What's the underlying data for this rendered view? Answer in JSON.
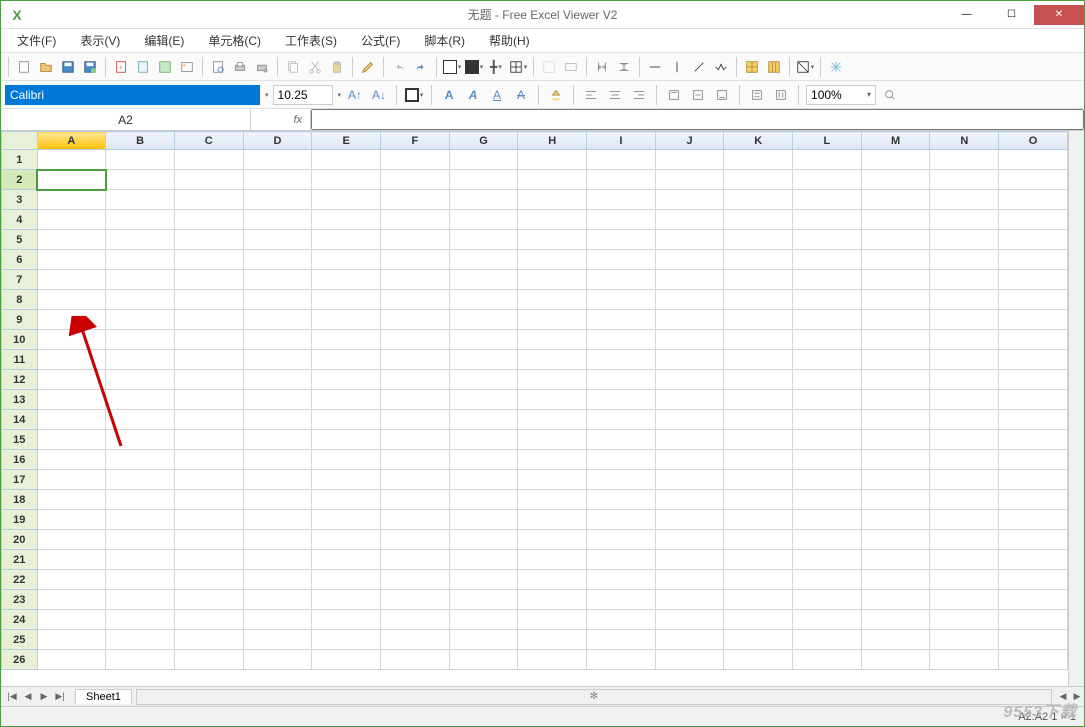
{
  "title": "无题 - Free Excel Viewer V2",
  "app_icon_letter": "X",
  "menus": [
    "文件(F)",
    "表示(V)",
    "编辑(E)",
    "单元格(C)",
    "工作表(S)",
    "公式(F)",
    "脚本(R)",
    "帮助(H)"
  ],
  "font": {
    "name": "Calibri",
    "size": "10.25"
  },
  "zoom": "100%",
  "cell_ref": "A2",
  "fx_label": "fx",
  "columns": [
    "A",
    "B",
    "C",
    "D",
    "E",
    "F",
    "G",
    "H",
    "I",
    "J",
    "K",
    "L",
    "M",
    "N",
    "O"
  ],
  "rows": [
    "1",
    "2",
    "3",
    "4",
    "5",
    "6",
    "7",
    "8",
    "9",
    "10",
    "11",
    "12",
    "13",
    "14",
    "15",
    "16",
    "17",
    "18",
    "19",
    "20",
    "21",
    "22",
    "23",
    "24",
    "25",
    "26"
  ],
  "active_col": "A",
  "active_row": "2",
  "sheet_tab": "Sheet1",
  "status": "A2:A2 1 × 1",
  "watermark": "9553下载",
  "win": {
    "min": "—",
    "max": "☐",
    "close": "✕"
  },
  "nav": {
    "first": "|◀",
    "prev": "◀",
    "next": "▶",
    "last": "▶|"
  }
}
